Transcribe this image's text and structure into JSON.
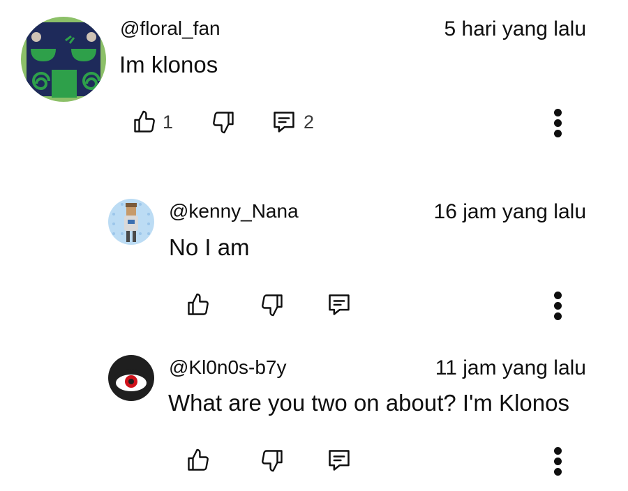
{
  "comments": [
    {
      "handle": "@floral_fan",
      "time": "5 hari yang lalu",
      "text": "Im klonos",
      "likes": "1",
      "replies": "2"
    },
    {
      "handle": "@kenny_Nana",
      "time": "16 jam yang lalu",
      "text": "No I am"
    },
    {
      "handle": "@Kl0n0s-b7y",
      "time": "11 jam yang lalu",
      "text": "What are you two on about? I'm Klonos"
    }
  ],
  "icons": {
    "like": "thumbs-up-icon",
    "dislike": "thumbs-down-icon",
    "reply": "reply-comment-icon",
    "more": "more-vertical-icon"
  },
  "colors": {
    "text": "#0f0f0f",
    "count": "#3a3a3a",
    "avatar1_bg": "#8cc068",
    "avatar1_face": "#1e2a5a",
    "avatar1_green": "#2ea04a",
    "avatar2_bg": "#bcdcf4",
    "avatar3_bg": "#1f1f1f",
    "avatar3_eye": "#d0121b"
  }
}
